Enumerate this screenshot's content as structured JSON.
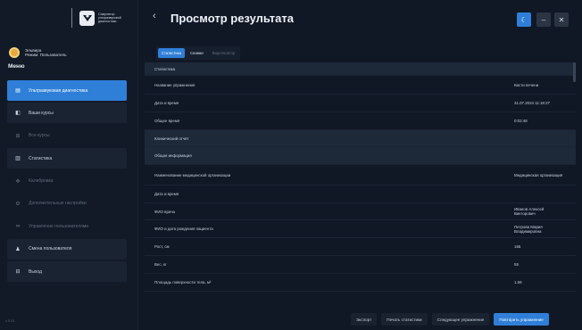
{
  "logo": {
    "text": "Симулятор ультразвуковой диагностики"
  },
  "user": {
    "name": "Эльвира",
    "role": "Режим: Пользователь"
  },
  "menu": {
    "title": "Меню",
    "items": [
      {
        "icon": "ultrasound-icon",
        "glyph": "▤",
        "label": "Ультразвуковая диагностика",
        "state": "active"
      },
      {
        "icon": "courses-icon",
        "glyph": "◧",
        "label": "Ваши курсы",
        "state": "normal"
      },
      {
        "icon": "all-courses-icon",
        "glyph": "⊞",
        "label": "Все курсы",
        "state": "dim"
      },
      {
        "icon": "statistics-icon",
        "glyph": "▥",
        "label": "Статистика",
        "state": "normal"
      },
      {
        "icon": "calibration-icon",
        "glyph": "✥",
        "label": "Калибровка",
        "state": "dim"
      },
      {
        "icon": "settings-icon",
        "glyph": "⚙",
        "label": "Дополнительные настройки",
        "state": "dim"
      },
      {
        "icon": "users-manage-icon",
        "glyph": "⇹",
        "label": "Управление пользователями",
        "state": "dim"
      },
      {
        "icon": "change-user-icon",
        "glyph": "♟",
        "label": "Смена пользователя",
        "state": "normal"
      },
      {
        "icon": "exit-icon",
        "glyph": "⊟",
        "label": "Выход",
        "state": "normal"
      }
    ]
  },
  "version": "v.0.01",
  "header": {
    "title": "Просмотр результата",
    "back": "‹"
  },
  "tabs": [
    {
      "label": "Статистика",
      "state": "active"
    },
    {
      "label": "Снимки",
      "state": "med"
    },
    {
      "label": "Видеоповтор",
      "state": "dim"
    }
  ],
  "table": {
    "rows": [
      {
        "label": "Статистика",
        "value": "",
        "section": true
      },
      {
        "label": "Название упражнения",
        "value": "Кисти печени",
        "section": false
      },
      {
        "label": "Дата и время",
        "value": "31.07.2024 11:18:27",
        "section": false
      },
      {
        "label": "Общее время",
        "value": "0:02:48",
        "section": false
      },
      {
        "label": "Клинический отчёт",
        "value": "",
        "section": true
      },
      {
        "label": "Общая информация",
        "value": "",
        "section": true
      },
      {
        "label": "Наименование медицинской организации",
        "value": "Медицинская организация",
        "section": false
      },
      {
        "label": "Дата и время",
        "value": "",
        "section": false
      },
      {
        "label": "ФИО врача",
        "value": "Иванов Алексей Викторович",
        "section": false
      },
      {
        "label": "ФИО и дата рождения пациента",
        "value": "Петрова Мария Владимировна",
        "section": false
      },
      {
        "label": "Рост, см",
        "value": "165",
        "section": false
      },
      {
        "label": "Вес, кг",
        "value": "55",
        "section": false
      },
      {
        "label": "Площадь поверхности тела, м²",
        "value": "1.59",
        "section": false
      }
    ]
  },
  "actions": {
    "export": "Экспорт",
    "print": "Печать статистики",
    "next": "Следующее упражнение",
    "repeat": "Повторить упражнение"
  },
  "colors": {
    "accent": "#2f7fd8",
    "sidebar": "#121a27",
    "main": "#101826"
  }
}
